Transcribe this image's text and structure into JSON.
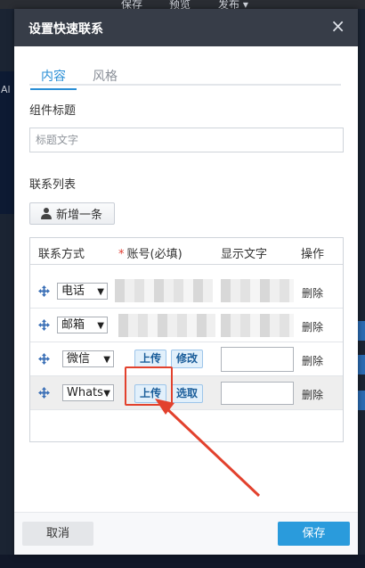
{
  "background": {
    "nav": [
      "保存",
      "预览",
      "发布 ▾"
    ],
    "left_label": "Al"
  },
  "dialog": {
    "title": "设置快速联系",
    "close_glyph": "×",
    "tabs": [
      {
        "label": "内容",
        "active": true
      },
      {
        "label": "风格",
        "active": false
      }
    ],
    "widget_title_label": "组件标题",
    "widget_title_placeholder": "标题文字",
    "widget_title_value": "",
    "contact_list_label": "联系列表",
    "add_button_label": "新增一条",
    "table": {
      "headers": {
        "method": "联系方式",
        "required_mark": "*",
        "account": "账号(必填)",
        "display": "显示文字",
        "action": "操作"
      },
      "rows": [
        {
          "method": "电话",
          "account_type": "text",
          "delete_label": "删除"
        },
        {
          "method": "邮箱",
          "account_type": "text",
          "delete_label": "删除"
        },
        {
          "method": "微信",
          "account_type": "upload",
          "upload_label": "上传",
          "second_label": "修改",
          "delete_label": "删除"
        },
        {
          "method": "Whats",
          "account_type": "upload",
          "upload_label": "上传",
          "second_label": "选取",
          "delete_label": "删除"
        }
      ]
    },
    "footer": {
      "cancel_label": "取消",
      "save_label": "保存"
    },
    "colors": {
      "accent": "#2a9bdc",
      "header_bg": "#373d48",
      "annotation": "#e2412d"
    }
  }
}
